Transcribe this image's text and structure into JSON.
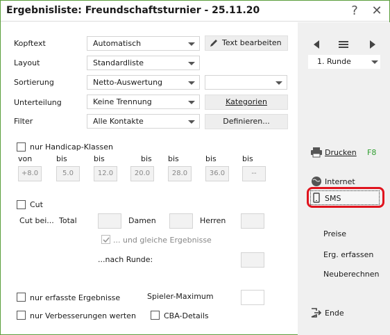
{
  "window": {
    "title": "Ergebnisliste: Freundschaftsturnier - 25.11.20",
    "help_label": "?",
    "close_label": "✕"
  },
  "form": {
    "kopftext": {
      "label": "Kopftext",
      "value": "Automatisch"
    },
    "layout": {
      "label": "Layout",
      "value": "Standardliste"
    },
    "sortierung": {
      "label": "Sortierung",
      "value": "Netto-Auswertung",
      "extra_value": ""
    },
    "unterteilung": {
      "label": "Unterteilung",
      "value": "Keine Trennung"
    },
    "filter": {
      "label": "Filter",
      "value": "Alle Kontakte"
    },
    "text_bearbeiten_label": "Text bearbeiten",
    "kategorien_label": "Kategorien",
    "definieren_label": "Definieren..."
  },
  "handicap": {
    "checkbox_label": "nur Handicap-Klassen",
    "checked": false,
    "headers": [
      "von",
      "bis",
      "bis",
      "bis",
      "bis",
      "bis",
      "bis"
    ],
    "values": [
      "+8.0",
      "5.0",
      "12.0",
      "20.0",
      "28.0",
      "36.0",
      "--"
    ]
  },
  "cut": {
    "checkbox_label": "Cut",
    "checked": false,
    "cut_bei_label": "Cut bei...",
    "total_label": "Total",
    "damen_label": "Damen",
    "herren_label": "Herren",
    "gleiche_label": "... und gleiche Ergebnisse",
    "gleiche_checked": true,
    "nach_runde_label": "...nach Runde:"
  },
  "options": {
    "erfasste_label": "nur erfasste Ergebnisse",
    "verbesserungen_label": "nur Verbesserungen werten",
    "spieler_max_label": "Spieler-Maximum",
    "cba_label": "CBA-Details"
  },
  "sidebar": {
    "runde_value": "1. Runde",
    "drucken_label": "Drucken",
    "drucken_shortcut": "F8",
    "internet_label": "Internet",
    "sms_label": "SMS",
    "preise_label": "Preise",
    "erg_erfassen_label": "Erg. erfassen",
    "neuberechnen_label": "Neuberechnen",
    "ende_label": "Ende",
    "shortcut_color": "#2e9e2e",
    "highlight_color": "#e0141e"
  }
}
